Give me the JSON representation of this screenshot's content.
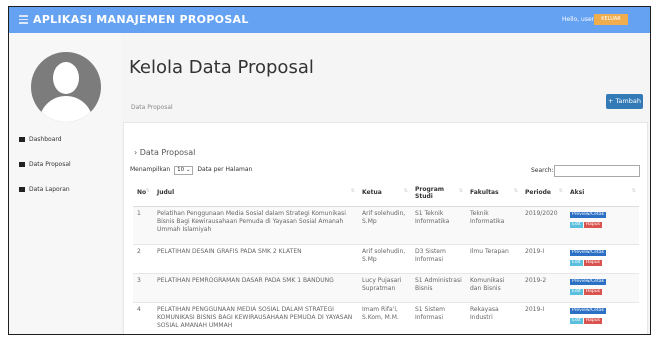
{
  "app": {
    "title": "APLIKASI MANAJEMEN PROPOSAL",
    "hello": "Hello, user",
    "logout_label": "KELUAR"
  },
  "sidebar": {
    "items": [
      {
        "label": "Dashboard"
      },
      {
        "label": "Data Proposal"
      },
      {
        "label": "Data Laporan"
      }
    ]
  },
  "main": {
    "page_title": "Kelola Data Proposal",
    "breadcrumb": "Data Proposal",
    "add_button": "+ Tambah",
    "panel_title": "› Data Proposal",
    "show_prefix": "Menampilkan",
    "show_value": "10",
    "show_suffix": "Data per Halaman",
    "search_label": "Search:"
  },
  "table": {
    "headers": [
      "No",
      "Judul",
      "Ketua",
      "Program Studi",
      "Fakultas",
      "Periode",
      "Aksi"
    ],
    "action_labels": {
      "preview": "Preview/Cetak",
      "edit": "Edit",
      "delete": "Hapus"
    },
    "rows": [
      {
        "no": "1",
        "judul": "Pelatihan Penggunaan Media Sosial dalam Strategi Komunikasi Bisnis Bagi Kewirausahaan Pemuda di Yayasan Sosial Amanah Ummah Islamiyah",
        "ketua": "Arif solehudin, S.Mp",
        "prodi": "S1 Teknik Informatika",
        "fakultas": "Teknik Informatika",
        "periode": "2019/2020"
      },
      {
        "no": "2",
        "judul": "PELATIHAN DESAIN GRAFIS PADA SMK 2 KLATEN",
        "ketua": "Arif solehudin, S.Mp",
        "prodi": "D3 Sistem Informasi",
        "fakultas": "Ilmu Terapan",
        "periode": "2019-I"
      },
      {
        "no": "3",
        "judul": "PELATIHAN PEMROGRAMAN DASAR PADA SMK 1 BANDUNG",
        "ketua": "Lucy Pujasari Supratman",
        "prodi": "S1 Administrasi Bisnis",
        "fakultas": "Komunikasi dan Bisnis",
        "periode": "2019-2"
      },
      {
        "no": "4",
        "judul": "PELATIHAN PENGGUNAAN MEDIA SOSIAL DALAM STRATEGI KOMUNIKASI BISNIS BAGI KEWIRAUSAHAAN PEMUDA DI YAYASAN SOSIAL AMANAH UMMAH",
        "ketua": "Imam Rifa'i, S.Kom, M.M.",
        "prodi": "S1 Sistem Informasi",
        "fakultas": "Rekayasa Industri",
        "periode": "2019-I"
      }
    ]
  },
  "colors": {
    "topbar": "#66a2f2",
    "logout": "#f0ad4e",
    "primary": "#337ab7",
    "preview": "#2b70c4",
    "edit": "#5bc0de",
    "delete": "#d9534f"
  },
  "icons": {
    "menu": "menu-icon",
    "dashboard": "dashboard-icon",
    "proposal": "document-icon",
    "laporan": "document-icon"
  }
}
